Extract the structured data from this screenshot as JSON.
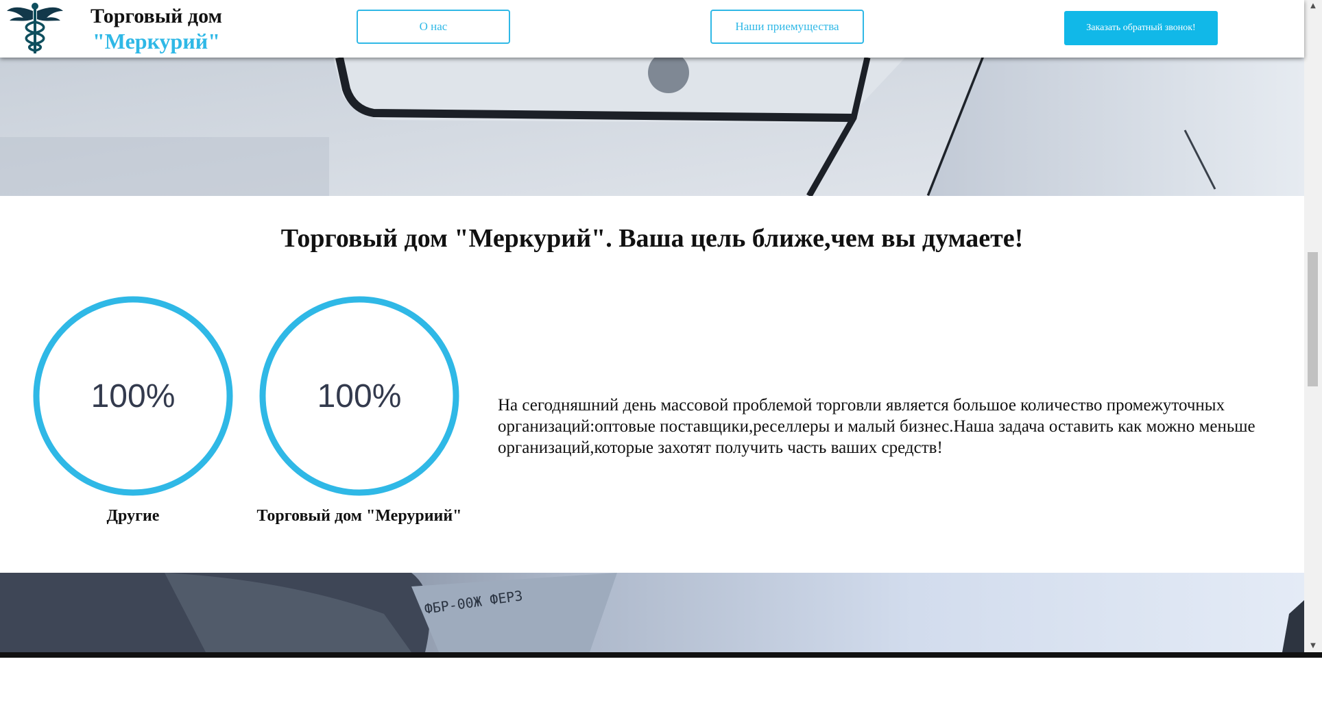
{
  "header": {
    "logo_icon": "caduceus-icon",
    "brand_line1": "Торговый дом",
    "brand_line2": "\"Меркурий\"",
    "nav": {
      "about_label": "О нас",
      "advantages_label": "Наши приемущества"
    },
    "cta_label": "Заказать обратный звонок!"
  },
  "main": {
    "headline": "Торговый дом \"Меркурий\". Ваша цель ближе,чем вы думаете!",
    "stats": [
      {
        "value": "100%",
        "label": "Другие",
        "progress": 1.0
      },
      {
        "value": "100%",
        "label": "Торговый дом \"Меруриий\"",
        "progress": 1.0
      }
    ],
    "paragraph": "На сегодняшний день массовой проблемой торговли является большое количество промежуточных организаций:оптовые поставщики,реселлеры и малый бизнес.Наша задача оставить как можно меньше организаций,которые захотят получить часть ваших средств!"
  },
  "colors": {
    "accent": "#2fb8e6",
    "cta_background": "#11b8e8",
    "text": "#111111",
    "circle_value": "#333a4d"
  }
}
